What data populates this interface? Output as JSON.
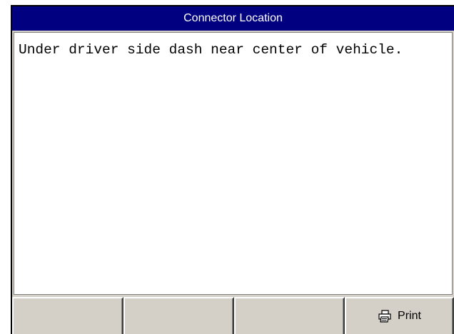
{
  "window": {
    "title": "Connector Location"
  },
  "content": {
    "text": "Under driver side dash near center of vehicle."
  },
  "function_keys": [
    {
      "label": ""
    },
    {
      "label": ""
    },
    {
      "label": ""
    },
    {
      "label": "Print",
      "icon": "printer-icon"
    }
  ]
}
